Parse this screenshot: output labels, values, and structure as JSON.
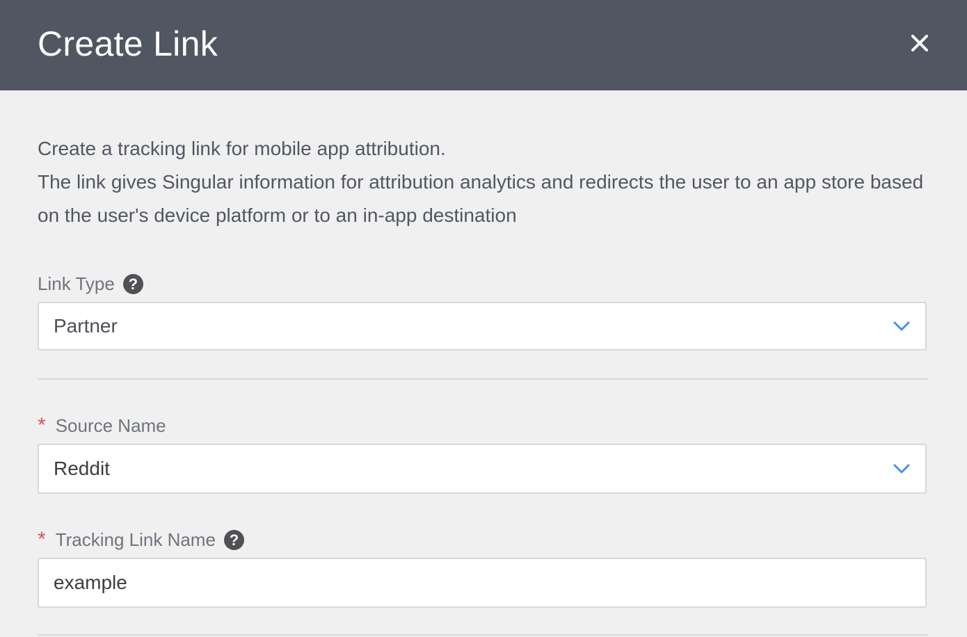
{
  "header": {
    "title": "Create Link",
    "close_icon": "close-icon"
  },
  "intro": {
    "line1": "Create a tracking link for mobile app attribution.",
    "line2": "The link gives Singular information for attribution analytics and redirects the user to an app store based on the user's device platform or to an in-app destination"
  },
  "fields": {
    "link_type": {
      "label": "Link Type",
      "help_icon": "?",
      "value": "Partner"
    },
    "source_name": {
      "required_mark": "*",
      "label": "Source Name",
      "value": "Reddit"
    },
    "tracking_link_name": {
      "required_mark": "*",
      "label": "Tracking Link Name",
      "help_icon": "?",
      "value": "example"
    }
  },
  "colors": {
    "header_bg": "#505762",
    "page_bg": "#f0f0f1",
    "required": "#d9534f",
    "chevron": "#4a90e2"
  }
}
